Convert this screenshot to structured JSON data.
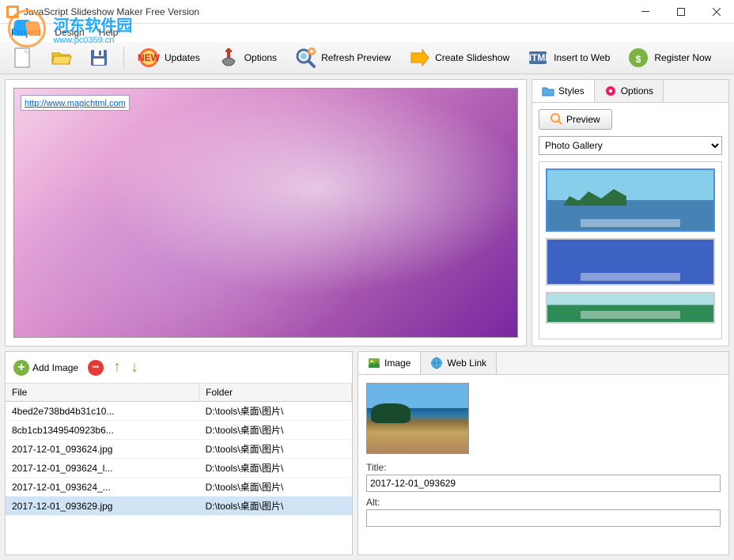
{
  "window": {
    "title": "JavaScript Slideshow Maker Free Version"
  },
  "watermark": {
    "text": "河东软件园",
    "url": "www.pc0359.cn"
  },
  "menu": {
    "project": "Project",
    "design": "Design",
    "help": "Help"
  },
  "toolbar": {
    "updates": "Updates",
    "options": "Options",
    "refresh_preview": "Refresh Preview",
    "create_slideshow": "Create Slideshow",
    "insert_to_web": "Insert to Web",
    "register_now": "Register Now"
  },
  "preview": {
    "link_text": "http://www.magichtml.com"
  },
  "right_panel": {
    "tab_styles": "Styles",
    "tab_options": "Options",
    "preview_btn": "Preview",
    "style_select": "Photo Gallery"
  },
  "image_list": {
    "add_image": "Add Image",
    "col_file": "File",
    "col_folder": "Folder",
    "rows": [
      {
        "file": "4bed2e738bd4b31c10...",
        "folder": "D:\\tools\\桌面\\图片\\"
      },
      {
        "file": "8cb1cb1349540923b6...",
        "folder": "D:\\tools\\桌面\\图片\\"
      },
      {
        "file": "2017-12-01_093624.jpg",
        "folder": "D:\\tools\\桌面\\图片\\"
      },
      {
        "file": "2017-12-01_093624_l...",
        "folder": "D:\\tools\\桌面\\图片\\"
      },
      {
        "file": "2017-12-01_093624_...",
        "folder": "D:\\tools\\桌面\\图片\\"
      },
      {
        "file": "2017-12-01_093629.jpg",
        "folder": "D:\\tools\\桌面\\图片\\"
      }
    ]
  },
  "detail": {
    "tab_image": "Image",
    "tab_weblink": "Web Link",
    "title_label": "Title:",
    "title_value": "2017-12-01_093629",
    "alt_label": "Alt:",
    "alt_value": ""
  }
}
